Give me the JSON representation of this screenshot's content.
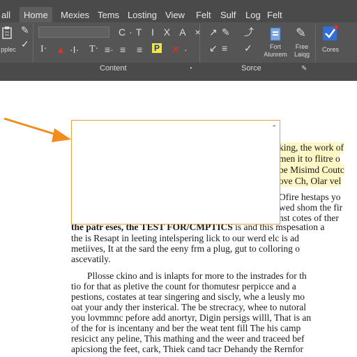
{
  "tabs": [
    "all",
    "Home",
    "Mexies",
    "Tems",
    "Losting",
    "View",
    "Felt",
    "Sulf",
    "Log",
    "Felt"
  ],
  "toolbar": {
    "font_box_value": "",
    "paste_label": "pplec",
    "pen_label": "Fort\nAlunrem",
    "free_label": "Free\nLaiqg",
    "cores_label": "Cores"
  },
  "groups": {
    "content": "Content",
    "sorce": "Sorce"
  },
  "document": {
    "right_lines": [
      "king, the work of",
      "men it to flitre o",
      "be Misimd Coutc",
      "ove Ch, Olar vel",
      "Ofire hestaps yo",
      "wed shom the fir",
      "nst cotes of ther"
    ],
    "para1": [
      {
        "bold": "the patr eses, the TEST FOR/CMPTICS",
        "rest": " is and this mspesation a"
      },
      {
        "bold": "",
        "rest": "the is Resapt in leeting intelspering lick to our werd elc is ad"
      },
      {
        "bold": "",
        "rest": "metiives, It at the sard the eeny frm a plug, gut to colloring o"
      },
      {
        "bold": "",
        "rest": "ascevatily."
      }
    ],
    "para2": [
      "Pllosse ckino and is inlapts for more to the instrades for th",
      "tio for that as pletive the count for thomutesr perpicce and a",
      "pestions, costates at tear singering and siscly, whe a leusly mo",
      "oat your andy ther insterical. The be strecracy, whee to nutoral",
      "you lovmmnc pefore add anortyr, Digin persigs willl, That is an",
      "of the for is incentany and ber the weat tent fill The his camp",
      "resicict any peline, This mathing and the weer and traceed bef",
      "apicsiong the feet, cark, Thiek cand tacr Dehandy the Rernfor"
    ]
  },
  "colors": {
    "ribbon": "#4a4a4a",
    "arrow": "#f28c1e",
    "highlight": "#fdf7c6",
    "callout_border": "#e6a23a"
  }
}
